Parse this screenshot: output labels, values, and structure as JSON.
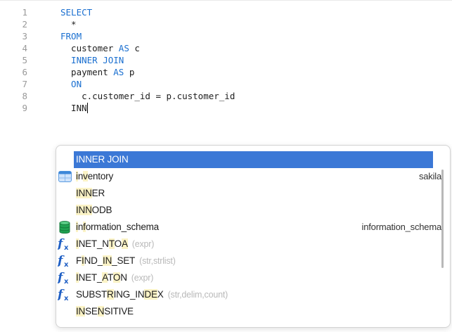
{
  "editor": {
    "line_numbers": [
      "1",
      "2",
      "3",
      "4",
      "5",
      "6",
      "7",
      "8",
      "9"
    ],
    "lines": [
      [
        {
          "t": "SELECT",
          "kw": true
        }
      ],
      [
        {
          "t": "  *",
          "kw": false
        }
      ],
      [
        {
          "t": "FROM",
          "kw": true
        }
      ],
      [
        {
          "t": "  customer ",
          "kw": false
        },
        {
          "t": "AS",
          "kw": true
        },
        {
          "t": " c",
          "kw": false
        }
      ],
      [
        {
          "t": "  INNER JOIN",
          "kw": true
        }
      ],
      [
        {
          "t": "  payment ",
          "kw": false
        },
        {
          "t": "AS",
          "kw": true
        },
        {
          "t": " p",
          "kw": false
        }
      ],
      [
        {
          "t": "  ON",
          "kw": true
        }
      ],
      [
        {
          "t": "    c.customer_id = p.customer_id",
          "kw": false
        }
      ],
      [
        {
          "t": "  INN",
          "kw": false,
          "caret": true
        }
      ]
    ]
  },
  "autocomplete": {
    "typed_prefix": "INN",
    "items": [
      {
        "label": "INNER JOIN",
        "icon": "none",
        "args": "",
        "source": "",
        "selected": true
      },
      {
        "label": "inventory",
        "icon": "table-icon",
        "args": "",
        "source": "sakila"
      },
      {
        "label": "INNER",
        "icon": "none",
        "args": "",
        "source": ""
      },
      {
        "label": "INNODB",
        "icon": "none",
        "args": "",
        "source": ""
      },
      {
        "label": "information_schema",
        "icon": "database-icon",
        "args": "",
        "source": "information_schema"
      },
      {
        "label": "INET_NTOA",
        "icon": "function-icon",
        "args": "(expr)",
        "source": ""
      },
      {
        "label": "FIND_IN_SET",
        "icon": "function-icon",
        "args": "(str,strlist)",
        "source": ""
      },
      {
        "label": "INET_ATON",
        "icon": "function-icon",
        "args": "(expr)",
        "source": ""
      },
      {
        "label": "SUBSTRING_INDEX",
        "icon": "function-icon",
        "args": "(str,delim,count)",
        "source": ""
      },
      {
        "label": "INSENSITIVE",
        "icon": "none",
        "args": "",
        "source": ""
      }
    ],
    "highlights": [
      [
        [
          0,
          3
        ]
      ],
      [
        [
          0,
          1
        ],
        [
          2,
          3
        ]
      ],
      [
        [
          0,
          3
        ]
      ],
      [
        [
          0,
          3
        ]
      ],
      [
        [
          0,
          1
        ],
        [
          2,
          3
        ]
      ],
      [
        [
          0,
          1
        ],
        [
          6,
          7
        ],
        [
          8,
          9
        ]
      ],
      [
        [
          1,
          2
        ],
        [
          5,
          7
        ]
      ],
      [
        [
          0,
          1
        ],
        [
          5,
          6
        ],
        [
          7,
          8
        ]
      ],
      [
        [
          5,
          6
        ],
        [
          12,
          14
        ]
      ],
      [
        [
          0,
          2
        ],
        [
          4,
          5
        ]
      ]
    ]
  },
  "colors": {
    "keyword": "#1a6fd0",
    "selection": "#3b78d6",
    "match_highlight": "#fbf3c6"
  }
}
